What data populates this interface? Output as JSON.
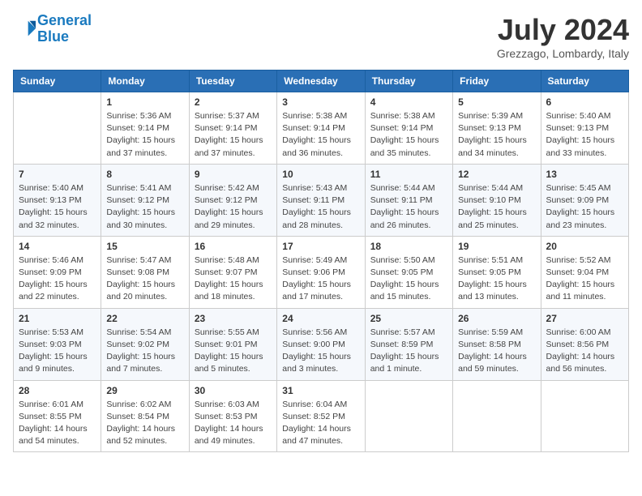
{
  "logo": {
    "line1": "General",
    "line2": "Blue"
  },
  "title": {
    "month_year": "July 2024",
    "location": "Grezzago, Lombardy, Italy"
  },
  "weekdays": [
    "Sunday",
    "Monday",
    "Tuesday",
    "Wednesday",
    "Thursday",
    "Friday",
    "Saturday"
  ],
  "weeks": [
    [
      {
        "day": "",
        "info": ""
      },
      {
        "day": "1",
        "info": "Sunrise: 5:36 AM\nSunset: 9:14 PM\nDaylight: 15 hours\nand 37 minutes."
      },
      {
        "day": "2",
        "info": "Sunrise: 5:37 AM\nSunset: 9:14 PM\nDaylight: 15 hours\nand 37 minutes."
      },
      {
        "day": "3",
        "info": "Sunrise: 5:38 AM\nSunset: 9:14 PM\nDaylight: 15 hours\nand 36 minutes."
      },
      {
        "day": "4",
        "info": "Sunrise: 5:38 AM\nSunset: 9:14 PM\nDaylight: 15 hours\nand 35 minutes."
      },
      {
        "day": "5",
        "info": "Sunrise: 5:39 AM\nSunset: 9:13 PM\nDaylight: 15 hours\nand 34 minutes."
      },
      {
        "day": "6",
        "info": "Sunrise: 5:40 AM\nSunset: 9:13 PM\nDaylight: 15 hours\nand 33 minutes."
      }
    ],
    [
      {
        "day": "7",
        "info": "Sunrise: 5:40 AM\nSunset: 9:13 PM\nDaylight: 15 hours\nand 32 minutes."
      },
      {
        "day": "8",
        "info": "Sunrise: 5:41 AM\nSunset: 9:12 PM\nDaylight: 15 hours\nand 30 minutes."
      },
      {
        "day": "9",
        "info": "Sunrise: 5:42 AM\nSunset: 9:12 PM\nDaylight: 15 hours\nand 29 minutes."
      },
      {
        "day": "10",
        "info": "Sunrise: 5:43 AM\nSunset: 9:11 PM\nDaylight: 15 hours\nand 28 minutes."
      },
      {
        "day": "11",
        "info": "Sunrise: 5:44 AM\nSunset: 9:11 PM\nDaylight: 15 hours\nand 26 minutes."
      },
      {
        "day": "12",
        "info": "Sunrise: 5:44 AM\nSunset: 9:10 PM\nDaylight: 15 hours\nand 25 minutes."
      },
      {
        "day": "13",
        "info": "Sunrise: 5:45 AM\nSunset: 9:09 PM\nDaylight: 15 hours\nand 23 minutes."
      }
    ],
    [
      {
        "day": "14",
        "info": "Sunrise: 5:46 AM\nSunset: 9:09 PM\nDaylight: 15 hours\nand 22 minutes."
      },
      {
        "day": "15",
        "info": "Sunrise: 5:47 AM\nSunset: 9:08 PM\nDaylight: 15 hours\nand 20 minutes."
      },
      {
        "day": "16",
        "info": "Sunrise: 5:48 AM\nSunset: 9:07 PM\nDaylight: 15 hours\nand 18 minutes."
      },
      {
        "day": "17",
        "info": "Sunrise: 5:49 AM\nSunset: 9:06 PM\nDaylight: 15 hours\nand 17 minutes."
      },
      {
        "day": "18",
        "info": "Sunrise: 5:50 AM\nSunset: 9:05 PM\nDaylight: 15 hours\nand 15 minutes."
      },
      {
        "day": "19",
        "info": "Sunrise: 5:51 AM\nSunset: 9:05 PM\nDaylight: 15 hours\nand 13 minutes."
      },
      {
        "day": "20",
        "info": "Sunrise: 5:52 AM\nSunset: 9:04 PM\nDaylight: 15 hours\nand 11 minutes."
      }
    ],
    [
      {
        "day": "21",
        "info": "Sunrise: 5:53 AM\nSunset: 9:03 PM\nDaylight: 15 hours\nand 9 minutes."
      },
      {
        "day": "22",
        "info": "Sunrise: 5:54 AM\nSunset: 9:02 PM\nDaylight: 15 hours\nand 7 minutes."
      },
      {
        "day": "23",
        "info": "Sunrise: 5:55 AM\nSunset: 9:01 PM\nDaylight: 15 hours\nand 5 minutes."
      },
      {
        "day": "24",
        "info": "Sunrise: 5:56 AM\nSunset: 9:00 PM\nDaylight: 15 hours\nand 3 minutes."
      },
      {
        "day": "25",
        "info": "Sunrise: 5:57 AM\nSunset: 8:59 PM\nDaylight: 15 hours\nand 1 minute."
      },
      {
        "day": "26",
        "info": "Sunrise: 5:59 AM\nSunset: 8:58 PM\nDaylight: 14 hours\nand 59 minutes."
      },
      {
        "day": "27",
        "info": "Sunrise: 6:00 AM\nSunset: 8:56 PM\nDaylight: 14 hours\nand 56 minutes."
      }
    ],
    [
      {
        "day": "28",
        "info": "Sunrise: 6:01 AM\nSunset: 8:55 PM\nDaylight: 14 hours\nand 54 minutes."
      },
      {
        "day": "29",
        "info": "Sunrise: 6:02 AM\nSunset: 8:54 PM\nDaylight: 14 hours\nand 52 minutes."
      },
      {
        "day": "30",
        "info": "Sunrise: 6:03 AM\nSunset: 8:53 PM\nDaylight: 14 hours\nand 49 minutes."
      },
      {
        "day": "31",
        "info": "Sunrise: 6:04 AM\nSunset: 8:52 PM\nDaylight: 14 hours\nand 47 minutes."
      },
      {
        "day": "",
        "info": ""
      },
      {
        "day": "",
        "info": ""
      },
      {
        "day": "",
        "info": ""
      }
    ]
  ]
}
